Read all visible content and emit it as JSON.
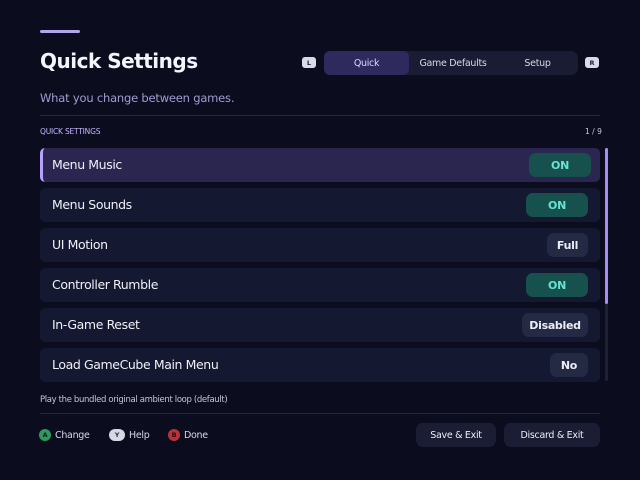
{
  "header": {
    "title": "Quick Settings",
    "subtitle": "What you change between games."
  },
  "tabs": {
    "left_shoulder": "L",
    "right_shoulder": "R",
    "items": [
      {
        "label": "Quick",
        "active": true
      },
      {
        "label": "Game Defaults",
        "active": false
      },
      {
        "label": "Setup",
        "active": false
      }
    ]
  },
  "section": {
    "label": "QUICK SETTINGS",
    "count": "1 / 9"
  },
  "settings": [
    {
      "label": "Menu Music",
      "value": "ON",
      "style": "toggle-on",
      "selected": true
    },
    {
      "label": "Menu Sounds",
      "value": "ON",
      "style": "toggle-on",
      "selected": false
    },
    {
      "label": "UI Motion",
      "value": "Full",
      "style": "value",
      "selected": false
    },
    {
      "label": "Controller Rumble",
      "value": "ON",
      "style": "toggle-on",
      "selected": false
    },
    {
      "label": "In-Game Reset",
      "value": "Disabled",
      "style": "value",
      "selected": false
    },
    {
      "label": "Load GameCube Main Menu",
      "value": "No",
      "style": "value",
      "selected": false
    }
  ],
  "scrollbar": {
    "visible_fraction": 0.67,
    "position_fraction": 0.0
  },
  "help_text": "Play the bundled original ambient loop (default)",
  "footer": {
    "hints": [
      {
        "glyph": "A",
        "label": "Change",
        "icon": "a-button-icon"
      },
      {
        "glyph": "Y",
        "label": "Help",
        "icon": "y-button-icon"
      },
      {
        "glyph": "B",
        "label": "Done",
        "icon": "b-button-icon"
      }
    ],
    "save_label": "Save & Exit",
    "discard_label": "Discard & Exit"
  },
  "colors": {
    "background": "#0b0d1e",
    "accent": "#b7a3ff",
    "toggle_on_bg": "#17514d",
    "toggle_on_text": "#68e3d4",
    "a_button": "#2e9a5f",
    "b_button": "#b8323a"
  }
}
